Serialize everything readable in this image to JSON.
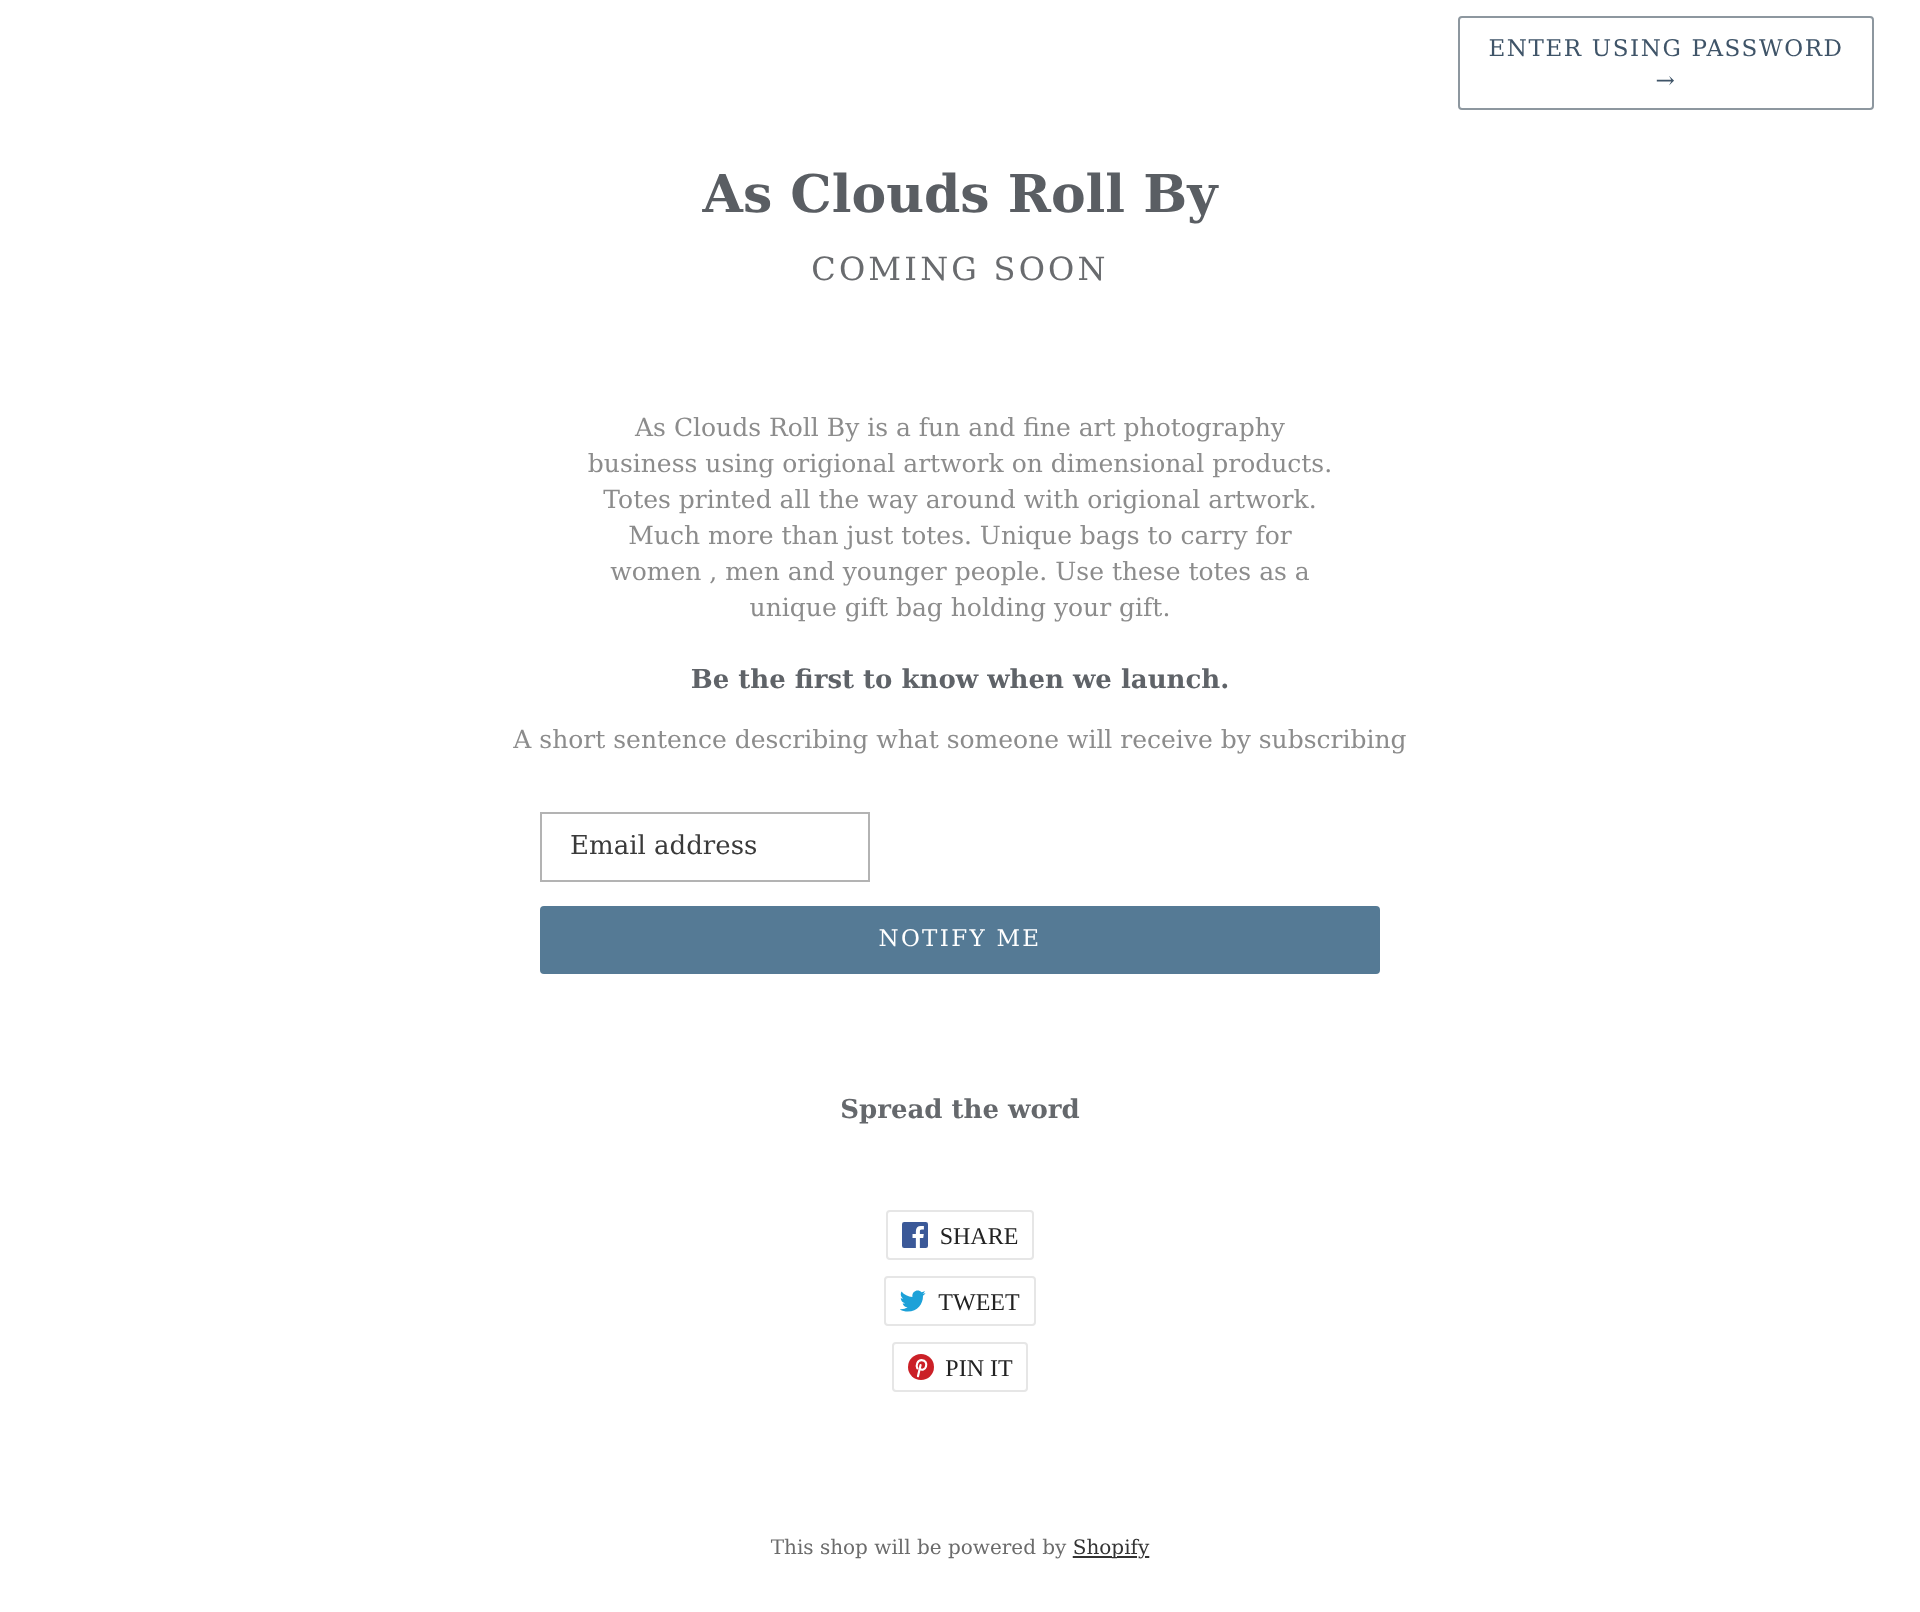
{
  "header": {
    "password_button": {
      "label": "ENTER USING PASSWORD",
      "arrow": "→"
    }
  },
  "hero": {
    "title": "As Clouds Roll By",
    "subtitle": "COMING SOON"
  },
  "description": "As Clouds Roll By is a fun and fine art photography business using origional artwork on dimensional products. Totes printed all the way around with origional artwork. Much more than just totes. Unique bags to carry for women , men and younger people. Use these totes as a unique gift bag holding your gift.",
  "signup": {
    "heading": "Be the first to know when we launch.",
    "text": "A short sentence describing what someone will receive by subscribing",
    "email_field": {
      "placeholder": "Email address"
    },
    "submit_button": "NOTIFY ME"
  },
  "share": {
    "heading": "Spread the word",
    "buttons": [
      {
        "kind": "facebook",
        "label": "SHARE"
      },
      {
        "kind": "twitter",
        "label": "TWEET"
      },
      {
        "kind": "pinterest",
        "label": "PIN IT"
      }
    ]
  },
  "footer": {
    "text": "This shop will be powered by",
    "link": "Shopify"
  }
}
